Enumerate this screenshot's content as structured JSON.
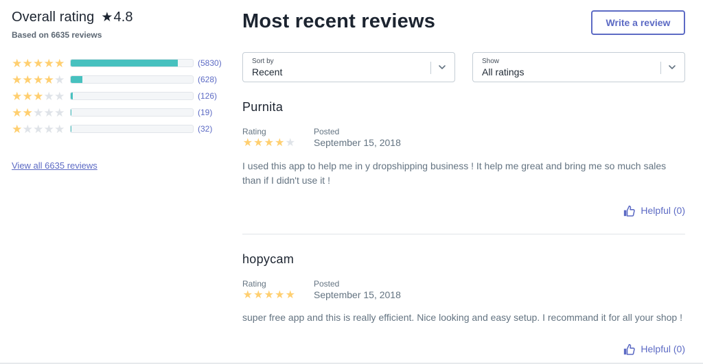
{
  "summary": {
    "title": "Overall rating",
    "star_glyph": "★",
    "score": "4.8",
    "based_on": "Based on 6635 reviews",
    "distribution": [
      {
        "stars": 5,
        "count": 5830,
        "count_label": "(5830)",
        "fraction": 0.879
      },
      {
        "stars": 4,
        "count": 628,
        "count_label": "(628)",
        "fraction": 0.095
      },
      {
        "stars": 3,
        "count": 126,
        "count_label": "(126)",
        "fraction": 0.019
      },
      {
        "stars": 2,
        "count": 19,
        "count_label": "(19)",
        "fraction": 0.003
      },
      {
        "stars": 1,
        "count": 32,
        "count_label": "(32)",
        "fraction": 0.005
      }
    ],
    "view_all": "View all 6635 reviews"
  },
  "main": {
    "title": "Most recent reviews",
    "write_button": "Write a review",
    "sort": {
      "label": "Sort by",
      "value": "Recent"
    },
    "show": {
      "label": "Show",
      "value": "All ratings"
    }
  },
  "reviews": [
    {
      "author": "Purnita",
      "rating_label": "Rating",
      "rating": 4,
      "posted_label": "Posted",
      "date": "September 15, 2018",
      "body": "I used this app to help me in y dropshipping business ! It help me great and bring me so much sales than if I didn't use it !",
      "helpful": "Helpful (0)"
    },
    {
      "author": "hopycam",
      "rating_label": "Rating",
      "rating": 5,
      "posted_label": "Posted",
      "date": "September 15, 2018",
      "body": "super free app and this is really efficient. Nice looking and easy setup. I recommand it for all your shop !",
      "helpful": "Helpful (0)"
    }
  ],
  "colors": {
    "accent": "#5c6ac4",
    "bar_fill": "#47c1bf",
    "star_on": "#ffcf70",
    "star_off": "#dfe3e8"
  }
}
